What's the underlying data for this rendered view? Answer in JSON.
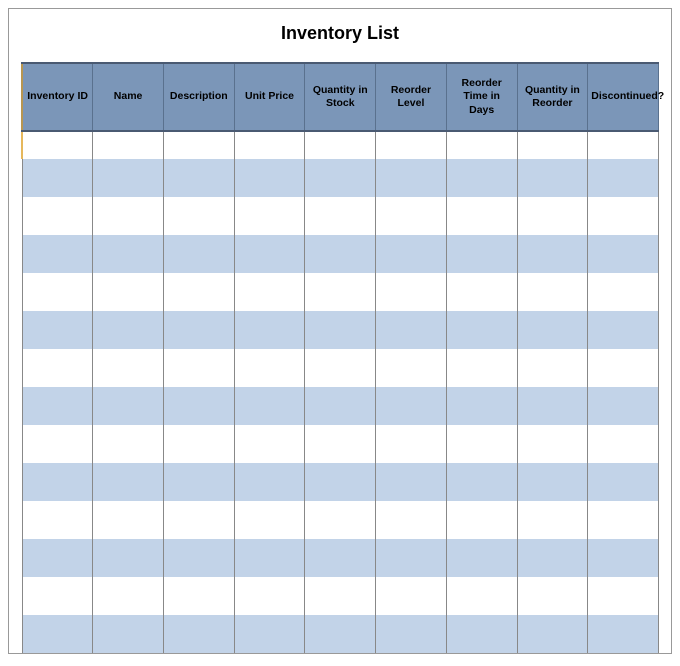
{
  "title": "Inventory List",
  "columns": [
    "Inventory ID",
    "Name",
    "Description",
    "Unit Price",
    "Quantity in Stock",
    "Reorder Level",
    "Reorder Time in Days",
    "Quantity in Reorder",
    "Discontinued?"
  ],
  "rows": [
    [
      "",
      "",
      "",
      "",
      "",
      "",
      "",
      "",
      ""
    ],
    [
      "",
      "",
      "",
      "",
      "",
      "",
      "",
      "",
      ""
    ],
    [
      "",
      "",
      "",
      "",
      "",
      "",
      "",
      "",
      ""
    ],
    [
      "",
      "",
      "",
      "",
      "",
      "",
      "",
      "",
      ""
    ],
    [
      "",
      "",
      "",
      "",
      "",
      "",
      "",
      "",
      ""
    ],
    [
      "",
      "",
      "",
      "",
      "",
      "",
      "",
      "",
      ""
    ],
    [
      "",
      "",
      "",
      "",
      "",
      "",
      "",
      "",
      ""
    ],
    [
      "",
      "",
      "",
      "",
      "",
      "",
      "",
      "",
      ""
    ],
    [
      "",
      "",
      "",
      "",
      "",
      "",
      "",
      "",
      ""
    ],
    [
      "",
      "",
      "",
      "",
      "",
      "",
      "",
      "",
      ""
    ],
    [
      "",
      "",
      "",
      "",
      "",
      "",
      "",
      "",
      ""
    ],
    [
      "",
      "",
      "",
      "",
      "",
      "",
      "",
      "",
      ""
    ],
    [
      "",
      "",
      "",
      "",
      "",
      "",
      "",
      "",
      ""
    ],
    [
      "",
      "",
      "",
      "",
      "",
      "",
      "",
      "",
      ""
    ]
  ]
}
